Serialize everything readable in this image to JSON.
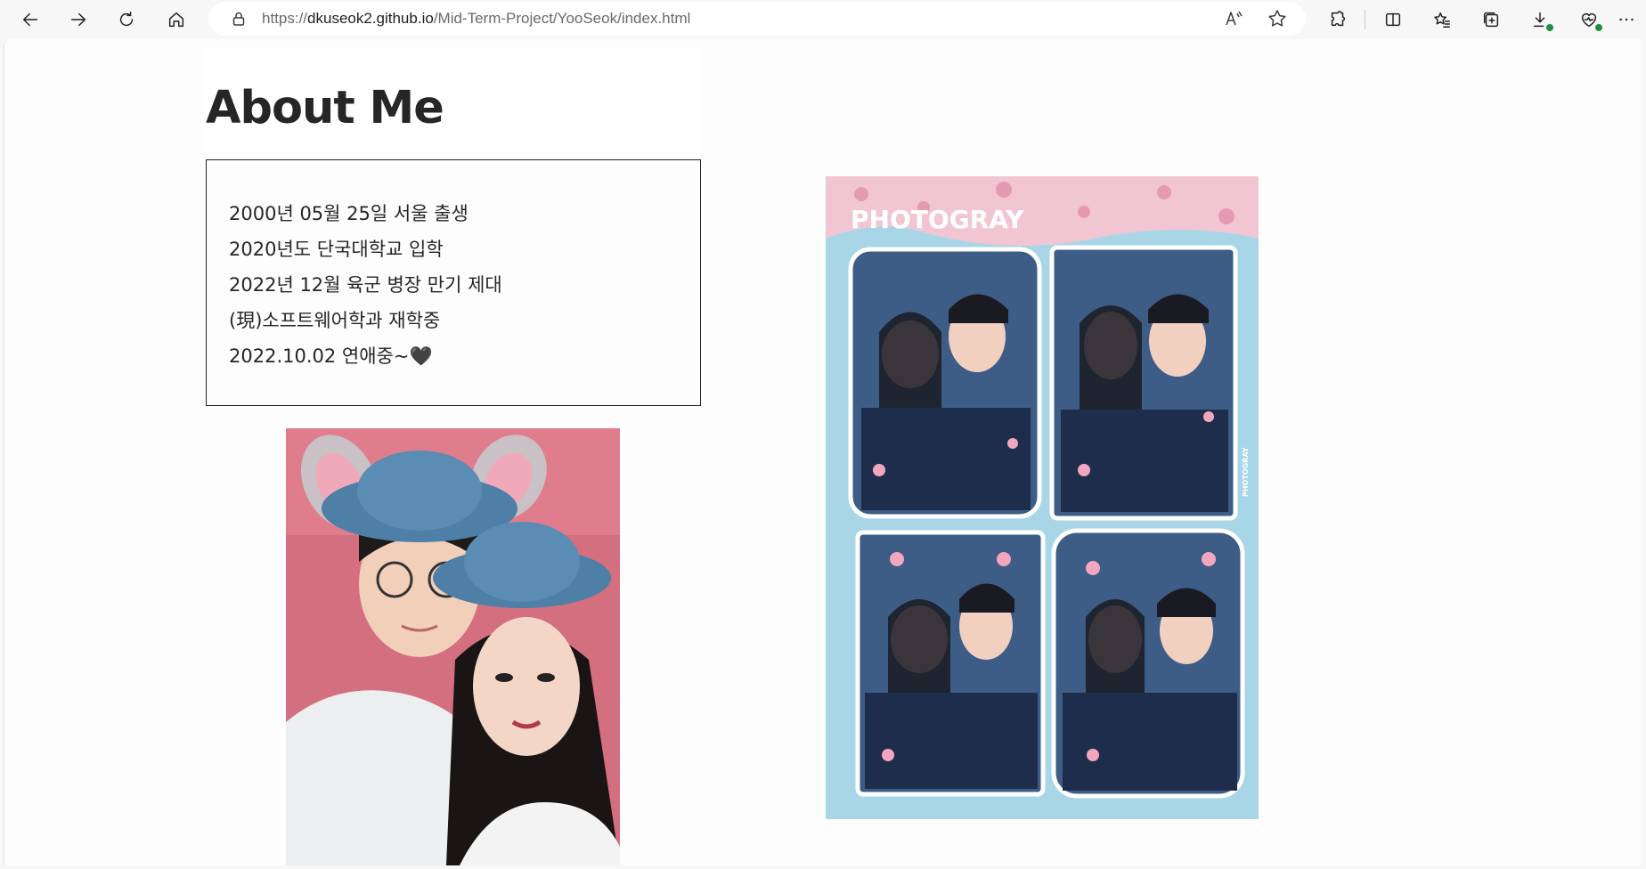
{
  "browser": {
    "url_prefix": "https://",
    "url_host": "dkuseok2.github.io",
    "url_path": "/Mid-Term-Project/YooSeok/index.html",
    "read_aloud": "A⁴",
    "icons": [
      "back-icon",
      "forward-icon",
      "refresh-icon",
      "home-icon",
      "lock-icon",
      "read-aloud-icon",
      "favorite-star-icon",
      "extensions-icon",
      "split-screen-icon",
      "favorites-icon",
      "collections-icon",
      "downloads-icon",
      "browser-essentials-icon",
      "more-icon"
    ]
  },
  "page": {
    "title": "About Me",
    "info_lines": [
      "2000년 05월 25일 서울 출생",
      "2020년도 단국대학교 입학",
      "2022년 12월 육군 병장 만기 제대",
      "(現)소프트웨어학과 재학중",
      "2022.10.02 연애중~🖤"
    ],
    "photo_booth_brand": "PHOTOGRAY",
    "photo_booth_side_label": "PHOTOGRAY"
  },
  "colors": {
    "chrome_bg": "#f7f7f7",
    "page_bg": "#fdfdfd",
    "text": "#262626",
    "selfie_bg": "#d9707f",
    "booth_bg": "#a9d6e6",
    "hat": "#4e7fa6",
    "navy_jacket": "#1f2d4d",
    "badge_green": "#1e8e3e"
  }
}
